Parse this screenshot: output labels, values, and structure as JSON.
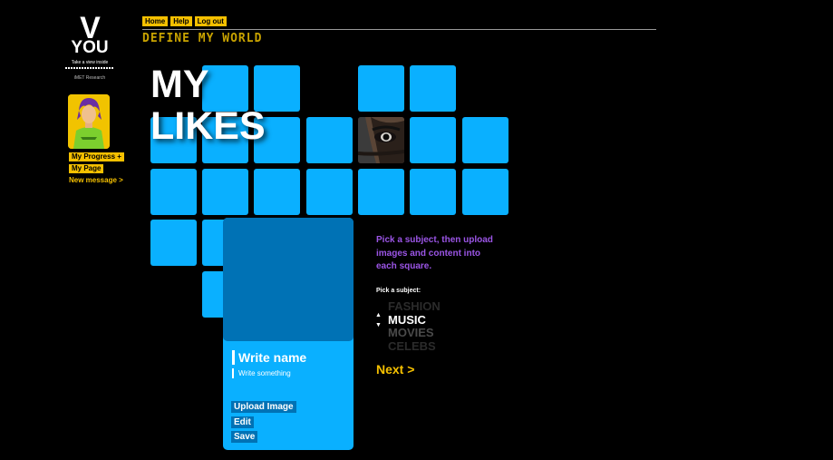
{
  "logo": {
    "letter": "V",
    "word": "YOU",
    "tagline": "Take a view inside",
    "org": "iMET Research"
  },
  "sidebar": {
    "progress_label": "My Progress +",
    "page_label": "My Page",
    "message_label": "New message >"
  },
  "nav": {
    "home": "Home",
    "help": "Help",
    "logout": "Log out"
  },
  "tagline": "DEFINE MY WORLD",
  "heading": {
    "line1": "MY",
    "line2": "LIKES"
  },
  "card": {
    "name_placeholder": "Write name",
    "desc_placeholder": "Write something",
    "upload_label": "Upload Image",
    "edit_label": "Edit",
    "save_label": "Save"
  },
  "panel": {
    "instructions": "Pick a subject, then upload images and content into each square.",
    "pick_label": "Pick a subject:",
    "subjects": [
      "FASHION",
      "MUSIC",
      "MOVIES",
      "CELEBS"
    ],
    "selected_subject": "MUSIC",
    "up_arrow": "▲",
    "down_arrow": "▼",
    "next_label": "Next >"
  },
  "colors": {
    "accent": "#f5c000",
    "tile": "#0ab0ff",
    "tile_dark": "#0072b5",
    "instructions": "#9b55e6"
  }
}
